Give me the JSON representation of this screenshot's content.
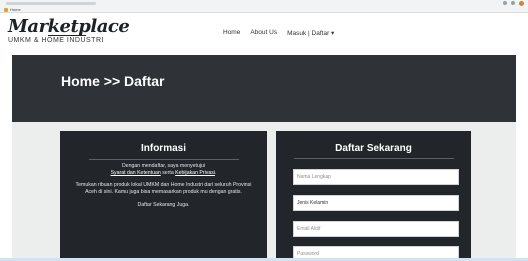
{
  "browser": {
    "tab_title": "Home"
  },
  "brand": {
    "name": "Marketplace",
    "tagline": "UMKM & HOME INDUSTRI"
  },
  "nav": {
    "home": "Home",
    "about": "About Us",
    "login": "Masuk | Daftar ▾"
  },
  "hero": {
    "title": "Home >> Daftar"
  },
  "info": {
    "title": "Informasi",
    "p1_line1": "Dengan mendaftar, saya menyetujui",
    "p1_link1": "Syarat dan Ketentuan",
    "p1_mid": " serta ",
    "p1_link2": "Kebijakan Privasi",
    "p1_end": ".",
    "p2": "Temukan ribuan produk lokal UMKM dan Home Industri dari seluruh Provinsi Aceh di sini. Kamu juga bisa memasarkan produk mu dengan gratis.",
    "p3": "Daftar Sekarang Juga."
  },
  "register": {
    "title": "Daftar Sekarang",
    "name_placeholder": "Nama Lengkap",
    "gender_value": "Jenis Kelamin",
    "email_placeholder": "Email Aktif",
    "password_placeholder": "Password"
  }
}
